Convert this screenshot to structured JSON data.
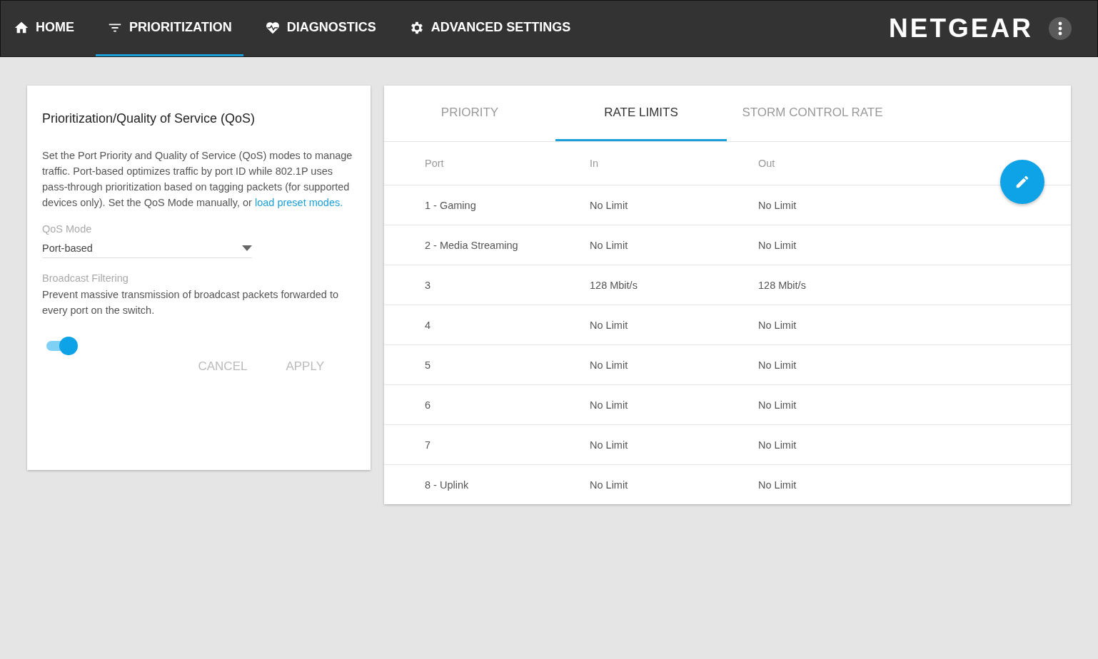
{
  "nav": {
    "items": [
      {
        "label": "HOME",
        "selected": false
      },
      {
        "label": "PRIORITIZATION",
        "selected": true
      },
      {
        "label": "DIAGNOSTICS",
        "selected": false
      },
      {
        "label": "ADVANCED SETTINGS",
        "selected": false
      }
    ],
    "brand": "NETGEAR"
  },
  "qos_card": {
    "title": "Prioritization/Quality of Service (QoS)",
    "description": "Set the Port Priority and Quality of Service (QoS) modes to manage traffic. Port-based optimizes traffic by port ID while 802.1P uses pass-through prioritization based on tagging packets (for supported devices only). Set the QoS Mode manually, or ",
    "description_link": "load preset modes.",
    "qos_mode": {
      "label": "QoS Mode",
      "value": "Port-based"
    },
    "broadcast_filtering": {
      "label": "Broadcast Filtering",
      "description": "Prevent massive transmission of broadcast packets forwarded to every port on the switch.",
      "on": true
    },
    "buttons": [
      "CANCEL",
      "APPLY"
    ]
  },
  "rates_card": {
    "tabs": [
      {
        "label": "PRIORITY",
        "selected": false
      },
      {
        "label": "RATE LIMITS",
        "selected": true
      },
      {
        "label": "STORM CONTROL RATE",
        "selected": false
      }
    ],
    "table": {
      "columns": [
        "Port",
        "In",
        "Out"
      ],
      "rows": [
        [
          "1 - Gaming",
          "No Limit",
          "No Limit"
        ],
        [
          "2 - Media Streaming",
          "No Limit",
          "No Limit"
        ],
        [
          "3",
          "128 Mbit/s",
          "128 Mbit/s"
        ],
        [
          "4",
          "No Limit",
          "No Limit"
        ],
        [
          "5",
          "No Limit",
          "No Limit"
        ],
        [
          "6",
          "No Limit",
          "No Limit"
        ],
        [
          "7",
          "No Limit",
          "No Limit"
        ],
        [
          "8 - Uplink",
          "No Limit",
          "No Limit"
        ]
      ]
    }
  }
}
